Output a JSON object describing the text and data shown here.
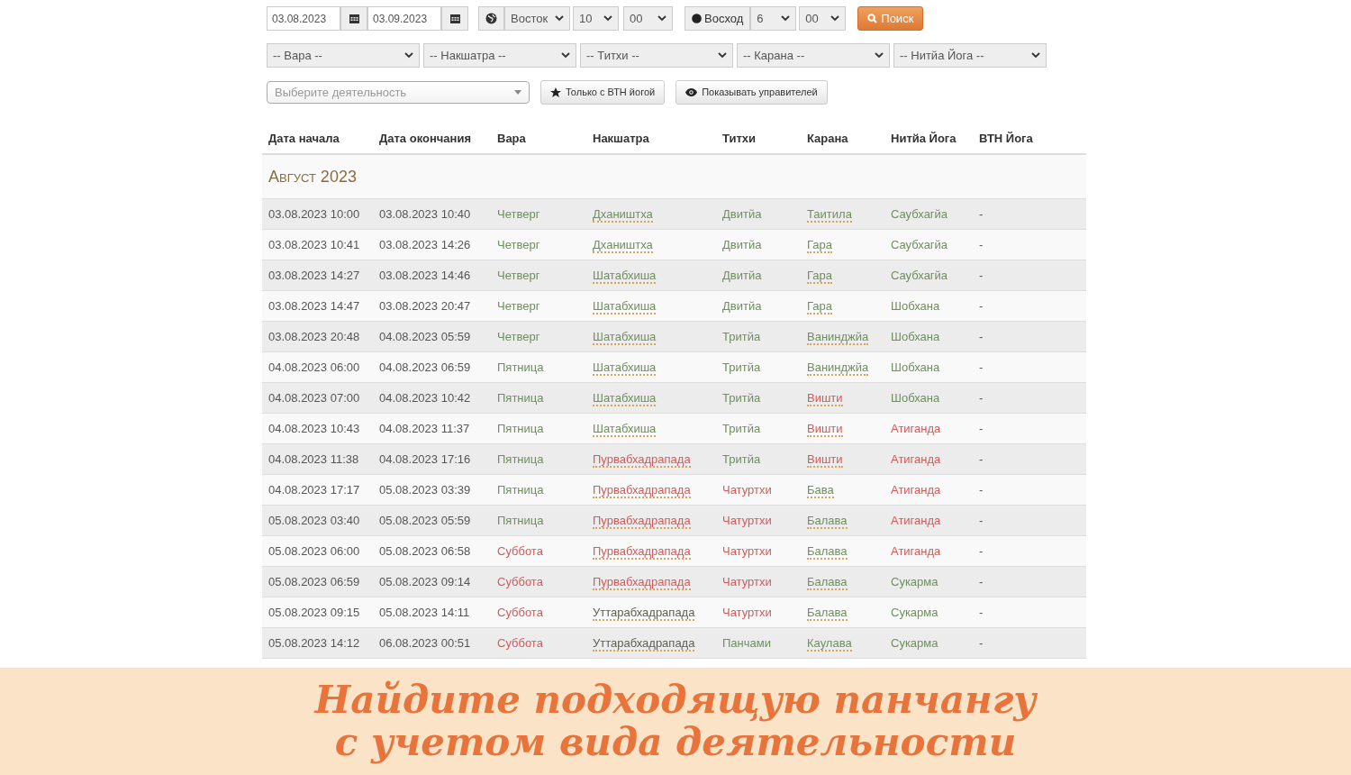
{
  "filters": {
    "date_from": "03.08.2023",
    "date_to": "03.09.2023",
    "direction": "Восток",
    "hour": "10",
    "minute": "00",
    "sun_event": "Восход",
    "sun_hour": "6",
    "sun_minute": "00",
    "search_button": "Поиск"
  },
  "selects": [
    "-- Вара --",
    "-- Накшатра --",
    "-- Титхи --",
    "-- Карана --",
    "-- Нитйа Йога --"
  ],
  "activity": {
    "placeholder": "Выберите деятельность"
  },
  "toggles": [
    "Только с ВТН йогой",
    "Показывать управителей"
  ],
  "table": {
    "columns": [
      "Дата начала",
      "Дата окончания",
      "Вара",
      "Накшатра",
      "Титхи",
      "Карана",
      "Нитйа Йога",
      "ВТН Йога"
    ],
    "month": "Август 2023",
    "rows": [
      {
        "start": "03.08.2023 10:00",
        "end": "03.08.2023 10:40",
        "vara": {
          "text": "Четверг",
          "color": "#6e8f5e"
        },
        "nakshatra": {
          "text": "Дхаништха",
          "color": "#6e8f5e"
        },
        "tithi": {
          "text": "Двитйа",
          "color": "#6e8f5e"
        },
        "karana": {
          "text": "Таитила",
          "color": "#6e8f5e"
        },
        "yoga": {
          "text": "Саубхагйа",
          "color": "#6e8f5e"
        },
        "vtn": "-"
      },
      {
        "start": "03.08.2023 10:41",
        "end": "03.08.2023 14:26",
        "vara": {
          "text": "Четверг",
          "color": "#6e8f5e"
        },
        "nakshatra": {
          "text": "Дхаништха",
          "color": "#6e8f5e"
        },
        "tithi": {
          "text": "Двитйа",
          "color": "#6e8f5e"
        },
        "karana": {
          "text": "Гара",
          "color": "#6e8f5e"
        },
        "yoga": {
          "text": "Саубхагйа",
          "color": "#6e8f5e"
        },
        "vtn": "-"
      },
      {
        "start": "03.08.2023 14:27",
        "end": "03.08.2023 14:46",
        "vara": {
          "text": "Четверг",
          "color": "#6e8f5e"
        },
        "nakshatra": {
          "text": "Шатабхиша",
          "color": "#6e8f5e"
        },
        "tithi": {
          "text": "Двитйа",
          "color": "#6e8f5e"
        },
        "karana": {
          "text": "Гара",
          "color": "#6e8f5e"
        },
        "yoga": {
          "text": "Саубхагйа",
          "color": "#6e8f5e"
        },
        "vtn": "-"
      },
      {
        "start": "03.08.2023 14:47",
        "end": "03.08.2023 20:47",
        "vara": {
          "text": "Четверг",
          "color": "#6e8f5e"
        },
        "nakshatra": {
          "text": "Шатабхиша",
          "color": "#6e8f5e"
        },
        "tithi": {
          "text": "Двитйа",
          "color": "#6e8f5e"
        },
        "karana": {
          "text": "Гара",
          "color": "#6e8f5e"
        },
        "yoga": {
          "text": "Шобхана",
          "color": "#6e8f5e"
        },
        "vtn": "-"
      },
      {
        "start": "03.08.2023 20:48",
        "end": "04.08.2023 05:59",
        "vara": {
          "text": "Четверг",
          "color": "#6e8f5e"
        },
        "nakshatra": {
          "text": "Шатабхиша",
          "color": "#6e8f5e"
        },
        "tithi": {
          "text": "Тритйа",
          "color": "#6e8f5e"
        },
        "karana": {
          "text": "Ванинджйа",
          "color": "#6e8f5e"
        },
        "yoga": {
          "text": "Шобхана",
          "color": "#6e8f5e"
        },
        "vtn": "-"
      },
      {
        "start": "04.08.2023 06:00",
        "end": "04.08.2023 06:59",
        "vara": {
          "text": "Пятница",
          "color": "#6e8f5e"
        },
        "nakshatra": {
          "text": "Шатабхиша",
          "color": "#6e8f5e"
        },
        "tithi": {
          "text": "Тритйа",
          "color": "#6e8f5e"
        },
        "karana": {
          "text": "Ванинджйа",
          "color": "#6e8f5e"
        },
        "yoga": {
          "text": "Шобхана",
          "color": "#6e8f5e"
        },
        "vtn": "-"
      },
      {
        "start": "04.08.2023 07:00",
        "end": "04.08.2023 10:42",
        "vara": {
          "text": "Пятница",
          "color": "#6e8f5e"
        },
        "nakshatra": {
          "text": "Шатабхиша",
          "color": "#6e8f5e"
        },
        "tithi": {
          "text": "Тритйа",
          "color": "#6e8f5e"
        },
        "karana": {
          "text": "Вишти",
          "color": "#d25a5a"
        },
        "yoga": {
          "text": "Шобхана",
          "color": "#6e8f5e"
        },
        "vtn": "-"
      },
      {
        "start": "04.08.2023 10:43",
        "end": "04.08.2023 11:37",
        "vara": {
          "text": "Пятница",
          "color": "#6e8f5e"
        },
        "nakshatra": {
          "text": "Шатабхиша",
          "color": "#6e8f5e"
        },
        "tithi": {
          "text": "Тритйа",
          "color": "#6e8f5e"
        },
        "karana": {
          "text": "Вишти",
          "color": "#d25a5a"
        },
        "yoga": {
          "text": "Атиганда",
          "color": "#d25a5a"
        },
        "vtn": "-"
      },
      {
        "start": "04.08.2023 11:38",
        "end": "04.08.2023 17:16",
        "vara": {
          "text": "Пятница",
          "color": "#6e8f5e"
        },
        "nakshatra": {
          "text": "Пурвабхадрапада",
          "color": "#d25a5a"
        },
        "tithi": {
          "text": "Тритйа",
          "color": "#6e8f5e"
        },
        "karana": {
          "text": "Вишти",
          "color": "#d25a5a"
        },
        "yoga": {
          "text": "Атиганда",
          "color": "#d25a5a"
        },
        "vtn": "-"
      },
      {
        "start": "04.08.2023 17:17",
        "end": "05.08.2023 03:39",
        "vara": {
          "text": "Пятница",
          "color": "#6e8f5e"
        },
        "nakshatra": {
          "text": "Пурвабхадрапада",
          "color": "#d25a5a"
        },
        "tithi": {
          "text": "Чатуртхи",
          "color": "#d25a5a"
        },
        "karana": {
          "text": "Бава",
          "color": "#6e8f5e"
        },
        "yoga": {
          "text": "Атиганда",
          "color": "#d25a5a"
        },
        "vtn": "-"
      },
      {
        "start": "05.08.2023 03:40",
        "end": "05.08.2023 05:59",
        "vara": {
          "text": "Пятница",
          "color": "#6e8f5e"
        },
        "nakshatra": {
          "text": "Пурвабхадрапада",
          "color": "#d25a5a"
        },
        "tithi": {
          "text": "Чатуртхи",
          "color": "#d25a5a"
        },
        "karana": {
          "text": "Балава",
          "color": "#6e8f5e"
        },
        "yoga": {
          "text": "Атиганда",
          "color": "#d25a5a"
        },
        "vtn": "-"
      },
      {
        "start": "05.08.2023 06:00",
        "end": "05.08.2023 06:58",
        "vara": {
          "text": "Суббота",
          "color": "#d25a5a"
        },
        "nakshatra": {
          "text": "Пурвабхадрапада",
          "color": "#d25a5a"
        },
        "tithi": {
          "text": "Чатуртхи",
          "color": "#d25a5a"
        },
        "karana": {
          "text": "Балава",
          "color": "#6e8f5e"
        },
        "yoga": {
          "text": "Атиганда",
          "color": "#d25a5a"
        },
        "vtn": "-"
      },
      {
        "start": "05.08.2023 06:59",
        "end": "05.08.2023 09:14",
        "vara": {
          "text": "Суббота",
          "color": "#d25a5a"
        },
        "nakshatra": {
          "text": "Пурвабхадрапада",
          "color": "#d25a5a"
        },
        "tithi": {
          "text": "Чатуртхи",
          "color": "#d25a5a"
        },
        "karana": {
          "text": "Балава",
          "color": "#6e8f5e"
        },
        "yoga": {
          "text": "Сукарма",
          "color": "#6e8f5e"
        },
        "vtn": "-"
      },
      {
        "start": "05.08.2023 09:15",
        "end": "05.08.2023 14:11",
        "vara": {
          "text": "Суббота",
          "color": "#d25a5a"
        },
        "nakshatra": {
          "text": "Уттарабхадрапада",
          "color": "#5f5f4f"
        },
        "tithi": {
          "text": "Чатуртхи",
          "color": "#d25a5a"
        },
        "karana": {
          "text": "Балава",
          "color": "#6e8f5e"
        },
        "yoga": {
          "text": "Сукарма",
          "color": "#6e8f5e"
        },
        "vtn": "-"
      },
      {
        "start": "05.08.2023 14:12",
        "end": "06.08.2023 00:51",
        "vara": {
          "text": "Суббота",
          "color": "#d25a5a"
        },
        "nakshatra": {
          "text": "Уттарабхадрапада",
          "color": "#5f5f4f"
        },
        "tithi": {
          "text": "Панчами",
          "color": "#6e8f5e"
        },
        "karana": {
          "text": "Каулава",
          "color": "#6e8f5e"
        },
        "yoga": {
          "text": "Сукарма",
          "color": "#6e8f5e"
        },
        "vtn": "-"
      }
    ]
  },
  "banner": {
    "lines": [
      "Найдите подходящую панчангу",
      "с учетом вида деятельности"
    ]
  }
}
